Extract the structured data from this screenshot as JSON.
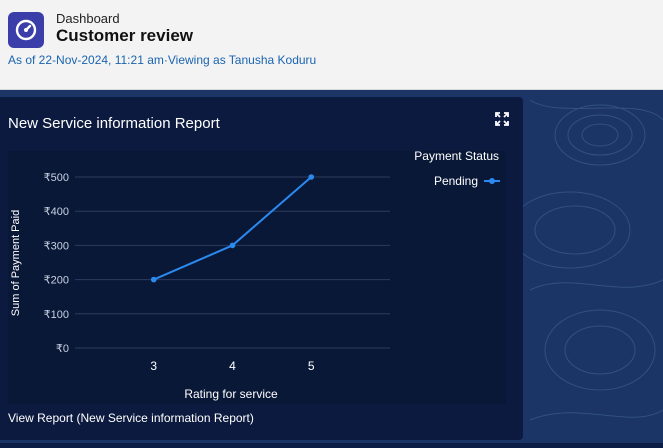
{
  "header": {
    "breadcrumb": "Dashboard",
    "title": "Customer review",
    "as_of": "As of 22-Nov-2024, 11:21 am",
    "separator": "·",
    "viewing_as": "Viewing as Tanusha Koduru"
  },
  "card": {
    "title": "New Service information Report",
    "view_report_link": "View Report (New Service information Report)",
    "expand_icon": "expand-icon"
  },
  "colors": {
    "accent": "#2b8af0",
    "card_bg": "#0c1a3f",
    "app_icon_bg": "#3b3ea8"
  },
  "chart_data": {
    "type": "line",
    "x": [
      3,
      4,
      5
    ],
    "xtick_labels": [
      "3",
      "4",
      "5"
    ],
    "series": [
      {
        "name": "Pending",
        "values": [
          200,
          300,
          500
        ]
      }
    ],
    "ytick_labels": [
      "₹0",
      "₹100",
      "₹200",
      "₹300",
      "₹400",
      "₹500"
    ],
    "yticks": [
      0,
      100,
      200,
      300,
      400,
      500
    ],
    "xlabel": "Rating for service",
    "ylabel": "Sum of Payment Paid",
    "ylim": [
      0,
      500
    ],
    "legend_title": "Payment Status",
    "legend_position": "top-right",
    "grid": true
  }
}
